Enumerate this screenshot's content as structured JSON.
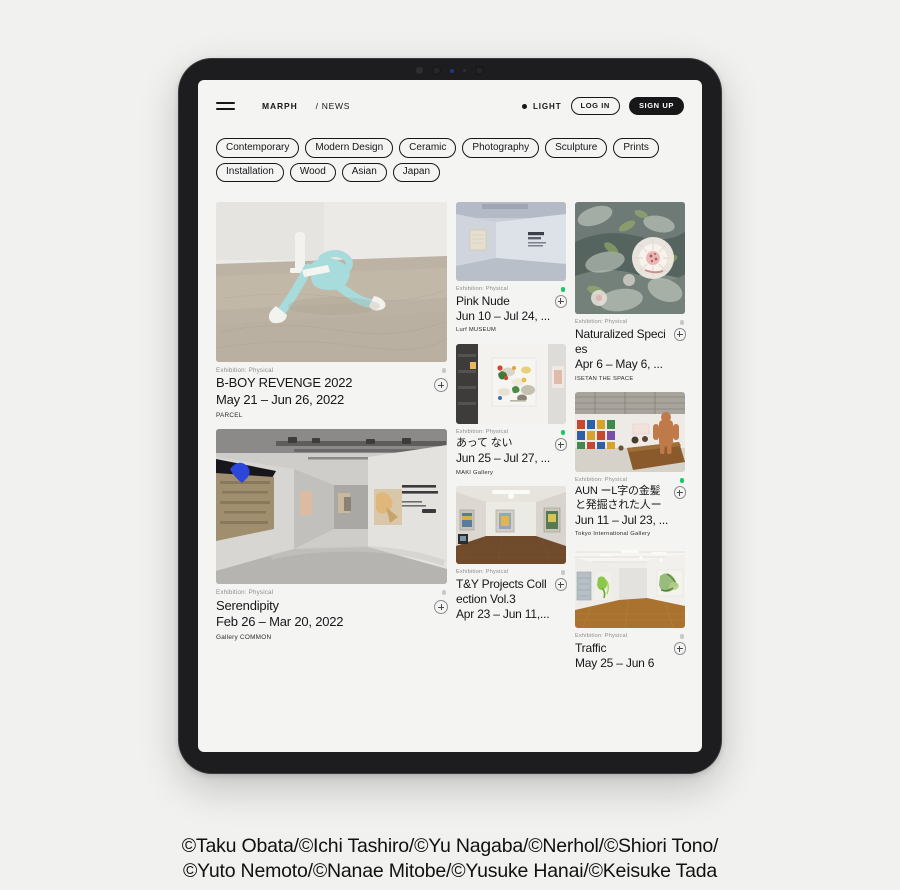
{
  "header": {
    "menu_icon": "hamburger-menu-icon",
    "brand": "MARPH",
    "breadcrumb": "/ NEWS",
    "theme_label": "LIGHT",
    "theme_dot_icon": "dot-icon",
    "login_label": "LOG IN",
    "signup_label": "SIGN UP"
  },
  "filters": {
    "tags": [
      "Contemporary",
      "Modern Design",
      "Ceramic",
      "Photography",
      "Sculpture",
      "Prints",
      "Installation",
      "Wood",
      "Asian",
      "Japan"
    ]
  },
  "grid": {
    "more_label": "...",
    "left_column": [
      {
        "type": "Exhibition: Physical",
        "title": "B-BOY REVENGE 2022",
        "date": "May 21 – Jun 26, 2022",
        "venue": "PARCEL",
        "status": "past",
        "image": "blue-figure-sculpture-on-concrete-floor",
        "add_icon": "plus-icon"
      },
      {
        "type": "Exhibition: Physical",
        "title": "Serendipity",
        "date": "Feb 26 – Mar 20, 2022",
        "venue": "Gallery COMMON",
        "status": "past",
        "image": "gallery-corridor-ichi-tashiro-serendipity",
        "add_icon": "plus-icon"
      }
    ],
    "middle_column": [
      {
        "type": "Exhibition: Physical",
        "title": "Pink Nude",
        "date": "Jun 10 – Jul 24, ...",
        "venue": "Lurf MUSEUM",
        "status": "live",
        "image": "blue-gray-gallery-room-with-framed-work",
        "add_icon": "plus-icon"
      },
      {
        "type": "Exhibition: Physical",
        "title": "あって ない",
        "date": "Jun 25 – Jul 27, ...",
        "venue": "MAKI Gallery",
        "status": "live",
        "image": "white-wall-with-colorful-table-painting",
        "add_icon": "plus-icon"
      },
      {
        "type": "Exhibition: Physical",
        "title": "T&Y Projects Collection Vol.3",
        "date": "Apr 23 – Jun 11,...",
        "venue": "",
        "status": "past",
        "image": "wood-floor-gallery-with-framed-paintings",
        "add_icon": "plus-icon"
      }
    ],
    "right_column": [
      {
        "type": "Exhibition: Physical",
        "title": "Naturalized Species",
        "date": "Apr 6 – May 6, ...",
        "venue": "ISETAN THE SPACE",
        "status": "past",
        "image": "floral-chrysanthemum-painting",
        "add_icon": "plus-icon"
      },
      {
        "type": "Exhibition: Physical",
        "title": "AUN ーL字の金髪と発掘された人ー",
        "date": "Jun 11 – Jul 23, ...",
        "venue": "Tokyo International Gallery",
        "status": "live",
        "image": "gallery-with-print-grid-and-soil-installation",
        "add_icon": "plus-icon"
      },
      {
        "type": "Exhibition: Physical",
        "title": "Traffic",
        "date": "May 25 – Jun 6",
        "venue": "",
        "status": "past",
        "image": "bright-gallery-wooden-floor-green-artworks",
        "add_icon": "plus-icon"
      }
    ]
  },
  "credits": {
    "line1": "©Taku Obata/©Ichi Tashiro/©Yu Nagaba/©Nerhol/©Shiori Tono/",
    "line2": "©Yuto Nemoto/©Nanae Mitobe/©Yusuke Hanai/©Keisuke Tada"
  },
  "colors": {
    "page_bg": "#f1f1ef",
    "screen_bg": "#f4f4f2",
    "ink": "#17171a",
    "device": "#1d1d1f",
    "status_live": "#19c964",
    "status_past": "#c9c9cc"
  }
}
